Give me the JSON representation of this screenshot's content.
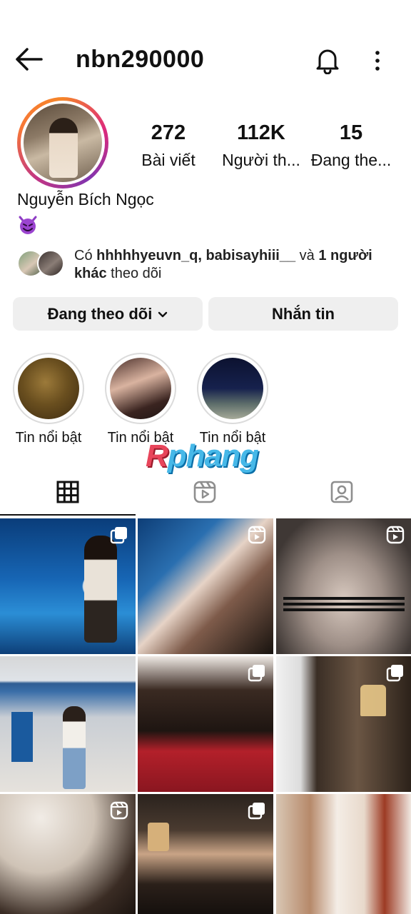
{
  "header": {
    "username": "nbn290000",
    "back_icon": "arrow-left-icon",
    "notification_icon": "bell-icon",
    "more_icon": "more-vertical-icon"
  },
  "profile": {
    "full_name": "Nguyễn Bích Ngọc",
    "bio_emoji": "😈",
    "stats": [
      {
        "value": "272",
        "label": "Bài viết"
      },
      {
        "value": "112K",
        "label": "Người th..."
      },
      {
        "value": "15",
        "label": "Đang the..."
      }
    ]
  },
  "mutual": {
    "prefix": "Có ",
    "names": "hhhhhyeuvn_q, babisayhiii__",
    "middle": " và ",
    "others_bold": "1 người khác",
    "suffix": " theo dõi"
  },
  "buttons": {
    "following": "Đang theo dõi",
    "message": "Nhắn tin"
  },
  "highlights": [
    {
      "label": "Tin nổi bật"
    },
    {
      "label": "Tin nổi bật"
    },
    {
      "label": "Tin nổi bật"
    }
  ],
  "watermark": {
    "first_letter": "R",
    "rest": "phang"
  },
  "tabs": [
    {
      "name": "grid-icon",
      "active": true
    },
    {
      "name": "reels-icon",
      "active": false
    },
    {
      "name": "tagged-icon",
      "active": false
    }
  ],
  "grid_posts": [
    {
      "badge": "carousel-icon"
    },
    {
      "badge": "reel-icon"
    },
    {
      "badge": "reel-icon"
    },
    {
      "badge": ""
    },
    {
      "badge": "carousel-icon"
    },
    {
      "badge": "carousel-icon"
    },
    {
      "badge": "reel-icon"
    },
    {
      "badge": "carousel-icon"
    },
    {
      "badge": ""
    }
  ],
  "colors": {
    "button_bg": "#efefef",
    "story_ring_start": "#f58529",
    "story_ring_mid": "#dd2a7b",
    "story_ring_end": "#8134af"
  }
}
